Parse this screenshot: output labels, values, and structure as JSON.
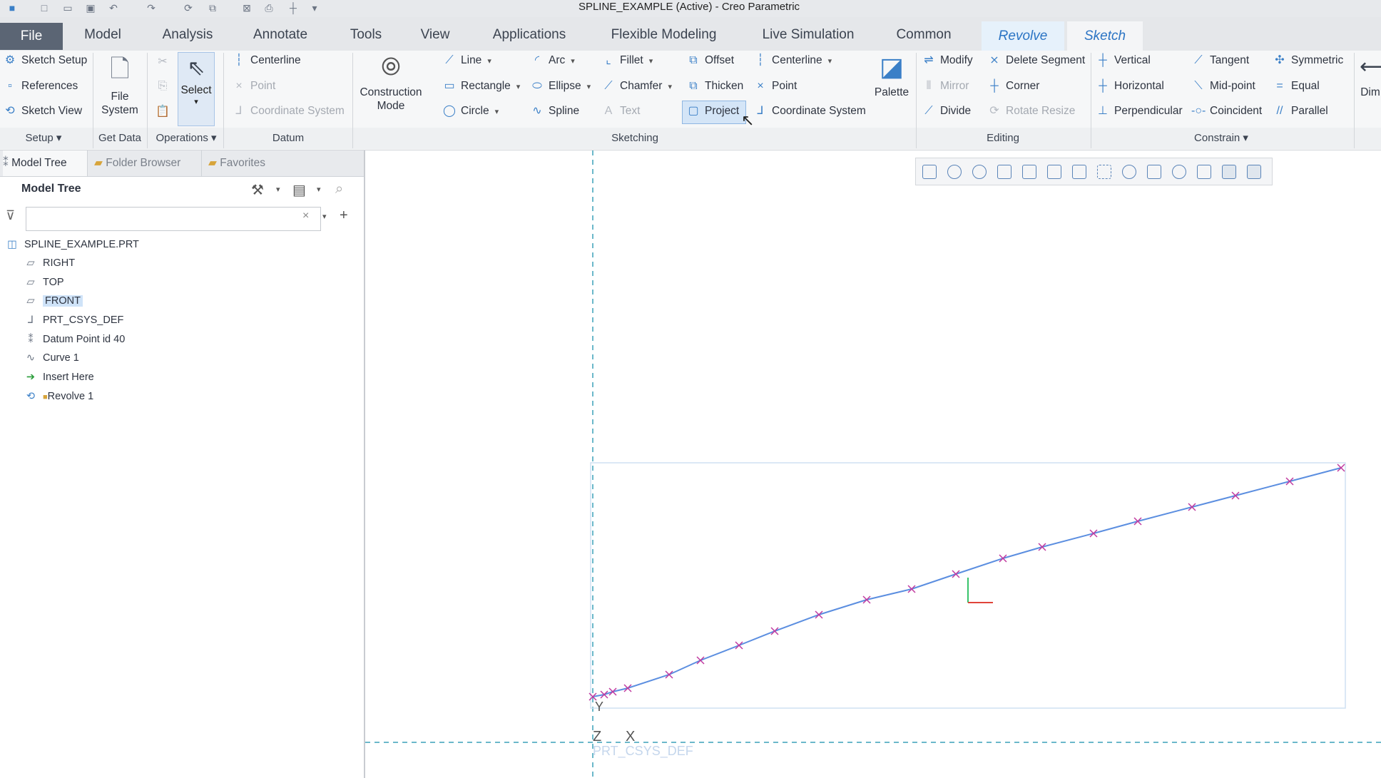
{
  "window": {
    "title": "SPLINE_EXAMPLE (Active) - Creo Parametric"
  },
  "tabs": [
    "File",
    "Model",
    "Analysis",
    "Annotate",
    "Tools",
    "View",
    "Applications",
    "Flexible Modeling",
    "Live Simulation",
    "Common",
    "Revolve",
    "Sketch"
  ],
  "ribbon": {
    "setup": {
      "sketch_setup": "Sketch Setup",
      "references": "References",
      "sketch_view": "Sketch View",
      "label": "Setup"
    },
    "get_data": {
      "file_system": "File System",
      "label": "Get Data"
    },
    "operations": {
      "select": "Select",
      "label": "Operations"
    },
    "datum": {
      "centerline": "Centerline",
      "point": "Point",
      "coordinate_system": "Coordinate System",
      "label": "Datum"
    },
    "construction_mode": "Construction Mode",
    "sketching": {
      "line": "Line",
      "rectangle": "Rectangle",
      "circle": "Circle",
      "arc": "Arc",
      "ellipse": "Ellipse",
      "spline": "Spline",
      "fillet": "Fillet",
      "chamfer": "Chamfer",
      "text": "Text",
      "offset": "Offset",
      "thicken": "Thicken",
      "project": "Project",
      "centerline": "Centerline",
      "point": "Point",
      "coordinate_system": "Coordinate System",
      "palette": "Palette",
      "label": "Sketching"
    },
    "editing": {
      "modify": "Modify",
      "delete_segment": "Delete Segment",
      "mirror": "Mirror",
      "corner": "Corner",
      "divide": "Divide",
      "rotate_resize": "Rotate Resize",
      "label": "Editing"
    },
    "constrain": {
      "vertical": "Vertical",
      "tangent": "Tangent",
      "symmetric": "Symmetric",
      "horizontal": "Horizontal",
      "mid_point": "Mid-point",
      "equal": "Equal",
      "perpendicular": "Perpendicular",
      "coincident": "Coincident",
      "parallel": "Parallel",
      "label": "Constrain"
    },
    "dim_partial": "Dim"
  },
  "left_panel": {
    "tabs": [
      "Model Tree",
      "Folder Browser",
      "Favorites"
    ],
    "header": "Model Tree",
    "items": [
      "SPLINE_EXAMPLE.PRT",
      "RIGHT",
      "TOP",
      "FRONT",
      "PRT_CSYS_DEF",
      "Datum Point id 40",
      "Curve 1",
      "Insert Here",
      "Revolve 1"
    ]
  },
  "graphics": {
    "y_label": "Y",
    "z_label": "Z",
    "x_label": "X",
    "csys_label": "PRT_CSYS_DEF"
  },
  "colors": {
    "accent": "#2b74c4",
    "spline": "#5b8ee0",
    "point_marker": "#c0399f",
    "file_tab": "#5b6574"
  }
}
